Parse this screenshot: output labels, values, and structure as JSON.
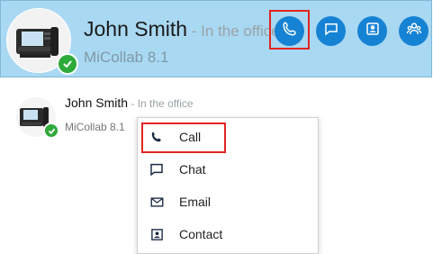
{
  "header_card": {
    "name": "John Smith",
    "presence": " - In the office",
    "product": "MiCollab 8.1",
    "status": "available",
    "actions": [
      {
        "label": "call",
        "icon": "phone-icon"
      },
      {
        "label": "chat",
        "icon": "chat-icon"
      },
      {
        "label": "contact",
        "icon": "contact-card-icon"
      },
      {
        "label": "group",
        "icon": "group-icon"
      }
    ],
    "colors": {
      "card_bg": "#a9d8f2",
      "action_bg": "#1682d4",
      "status": "#2eaa3a",
      "highlight": "#e0251f"
    }
  },
  "contact_entry": {
    "name": "John Smith",
    "presence": " - In the office",
    "product": "MiCollab 8.1"
  },
  "context_menu": {
    "items": [
      {
        "label": "Call",
        "icon": "phone-icon"
      },
      {
        "label": "Chat",
        "icon": "chat-icon"
      },
      {
        "label": "Email",
        "icon": "envelope-icon"
      },
      {
        "label": "Contact",
        "icon": "contact-card-icon"
      }
    ]
  }
}
